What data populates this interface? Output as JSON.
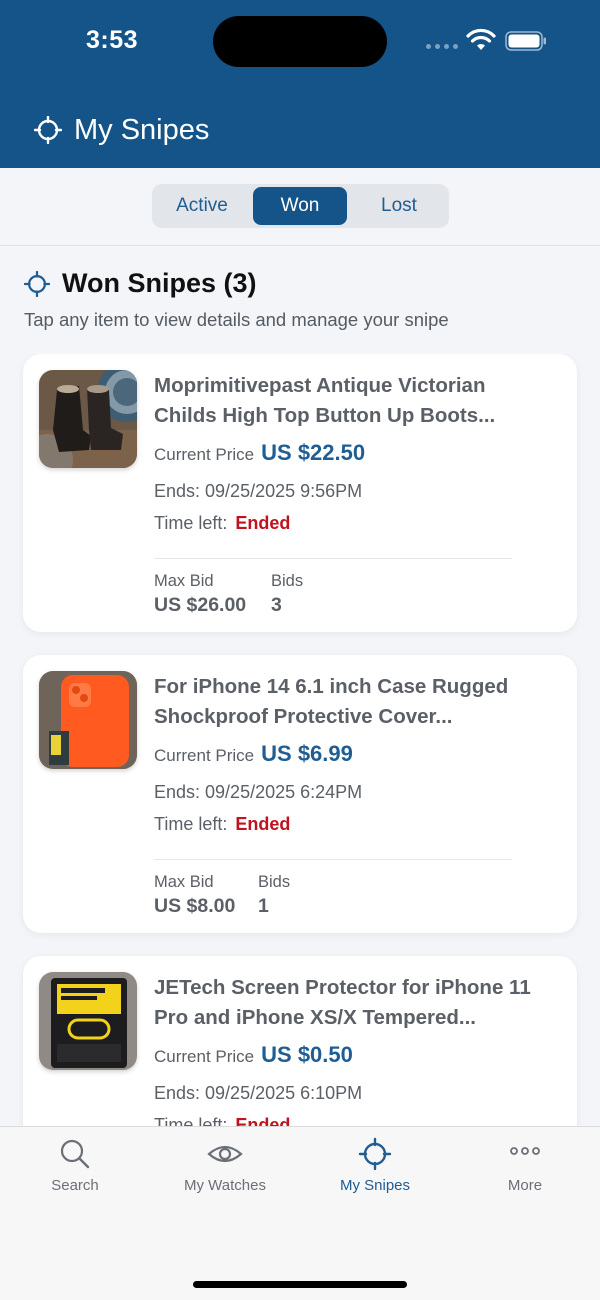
{
  "status": {
    "time": "3:53"
  },
  "header": {
    "title": "My Snipes"
  },
  "segments": [
    "Active",
    "Won",
    "Lost"
  ],
  "segment_selected": "Won",
  "section": {
    "title": "Won Snipes (3)",
    "subtitle": "Tap any item to view details and manage your snipe"
  },
  "labels": {
    "current_price": "Current Price",
    "time_left": "Time left:",
    "max_bid": "Max Bid",
    "bids": "Bids"
  },
  "items": [
    {
      "title": "Moprimitivepast Antique Victorian Childs High Top Button Up Boots...",
      "price": "US $22.50",
      "ends": "Ends: 09/25/2025 9:56PM",
      "time_left": "Ended",
      "max_bid": "US $26.00",
      "bids": "3",
      "image": "boots-photo"
    },
    {
      "title": "For iPhone 14 6.1 inch Case Rugged Shockproof Protective Cover...",
      "price": "US $6.99",
      "ends": "Ends: 09/25/2025 6:24PM",
      "time_left": "Ended",
      "max_bid": "US $8.00",
      "bids": "1",
      "image": "orange-case-photo"
    },
    {
      "title": "JETech Screen Protector for iPhone 11 Pro and iPhone XS/X Tempered...",
      "price": "US $0.50",
      "ends": "Ends: 09/25/2025 6:10PM",
      "time_left": "Ended",
      "image": "screen-protector-photo"
    }
  ],
  "tabs": [
    {
      "label": "Search",
      "icon": "search-icon"
    },
    {
      "label": "My Watches",
      "icon": "eye-icon"
    },
    {
      "label": "My Snipes",
      "icon": "crosshair-icon"
    },
    {
      "label": "More",
      "icon": "more-icon"
    }
  ],
  "active_tab": "My Snipes",
  "colors": {
    "header": "#145489",
    "accent": "#1f5d93",
    "ended": "#c1121f",
    "background": "#f3f5f8"
  }
}
